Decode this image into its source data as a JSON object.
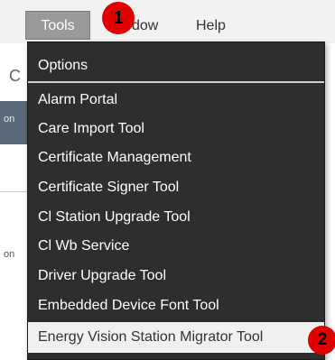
{
  "menubar": {
    "items": [
      {
        "label": "Tools"
      },
      {
        "label": "dow"
      },
      {
        "label": "Help"
      }
    ]
  },
  "badges": [
    {
      "label": "1"
    },
    {
      "label": "2"
    }
  ],
  "background": {
    "glyph": "C",
    "text_1": "on",
    "text_2": "on"
  },
  "tools_menu": {
    "items": [
      {
        "label": "Options"
      },
      {
        "label": "Alarm Portal"
      },
      {
        "label": "Care Import Tool"
      },
      {
        "label": "Certificate Management"
      },
      {
        "label": "Certificate Signer Tool"
      },
      {
        "label": "Cl Station Upgrade Tool"
      },
      {
        "label": "Cl Wb Service"
      },
      {
        "label": "Driver Upgrade Tool"
      },
      {
        "label": "Embedded Device Font Tool"
      },
      {
        "label": "Energy Vision Station Migrator Tool",
        "highlighted": true
      }
    ]
  },
  "colors": {
    "menu_bg": "#2e2e2e",
    "highlight_bg": "#f0f0f0",
    "badge": "#e00000"
  }
}
